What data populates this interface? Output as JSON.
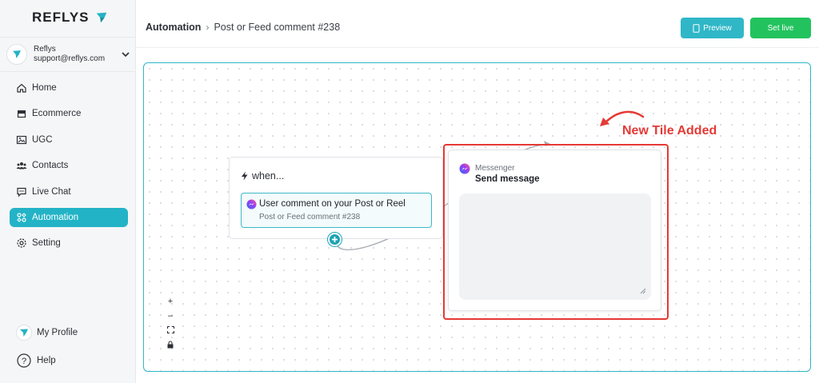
{
  "brand": {
    "name": "REFLYS",
    "accent": "#23b3c6"
  },
  "account": {
    "name": "Reflys",
    "email": "support@reflys.com"
  },
  "sidebar": {
    "items": [
      {
        "label": "Home",
        "icon": "home-icon"
      },
      {
        "label": "Ecommerce",
        "icon": "store-icon"
      },
      {
        "label": "UGC",
        "icon": "image-icon"
      },
      {
        "label": "Contacts",
        "icon": "users-icon"
      },
      {
        "label": "Live Chat",
        "icon": "chat-icon"
      },
      {
        "label": "Automation",
        "icon": "automation-icon",
        "active": true
      },
      {
        "label": "Setting",
        "icon": "gear-icon"
      }
    ],
    "profile_label": "My Profile",
    "help_label": "Help"
  },
  "header": {
    "breadcrumb_root": "Automation",
    "breadcrumb_current": "Post or Feed comment #238",
    "preview_label": "Preview",
    "set_live_label": "Set live"
  },
  "canvas": {
    "trigger": {
      "when_label": "when...",
      "item_title": "User comment on your Post or Reel",
      "item_subtitle": "Post or Feed comment #238"
    },
    "message_tile": {
      "channel": "Messenger",
      "title": "Send message"
    },
    "annotation": "New Tile Added",
    "zoom": {
      "in": "+",
      "out": "–"
    }
  },
  "colors": {
    "highlight": "#e53935",
    "live": "#22c35e",
    "preview": "#2fb7c7"
  }
}
